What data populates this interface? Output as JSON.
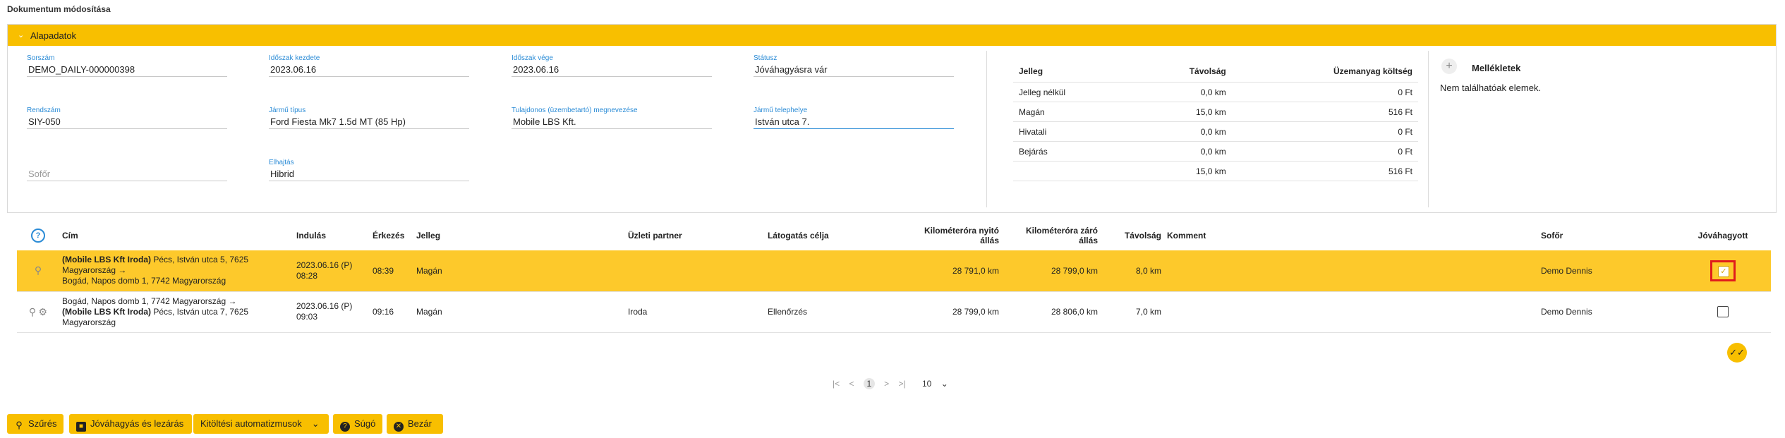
{
  "page_title": "Dokumentum módosítása",
  "panel": {
    "title": "Alapadatok",
    "fields": {
      "sorszam": {
        "label": "Sorszám",
        "value": "DEMO_DAILY-000000398"
      },
      "idoszak_kezdete": {
        "label": "Időszak kezdete",
        "value": "2023.06.16"
      },
      "idoszak_vege": {
        "label": "Időszak vége",
        "value": "2023.06.16"
      },
      "statusz": {
        "label": "Státusz",
        "value": "Jóváhagyásra vár"
      },
      "rendszam": {
        "label": "Rendszám",
        "value": "SIY-050"
      },
      "jarmu_tipus": {
        "label": "Jármű típus",
        "value": "Ford Fiesta Mk7 1.5d MT (85 Hp)"
      },
      "tulajdonos": {
        "label": "Tulajdonos (üzembetartó) megnevezése",
        "value": "Mobile LBS Kft."
      },
      "telephely": {
        "label": "Jármű telephelye",
        "value": "István utca 7."
      },
      "sofor": {
        "placeholder": "Sofőr"
      },
      "elohajtas": {
        "label": "Elhajtás",
        "value": "Hibrid"
      }
    },
    "summary": {
      "headers": {
        "jelleg": "Jelleg",
        "tavolsag": "Távolság",
        "koltseg": "Üzemanyag költség"
      },
      "rows": [
        {
          "jelleg": "Jelleg nélkül",
          "tavolsag": "0,0 km",
          "koltseg": "0 Ft"
        },
        {
          "jelleg": "Magán",
          "tavolsag": "15,0 km",
          "koltseg": "516 Ft"
        },
        {
          "jelleg": "Hivatali",
          "tavolsag": "0,0 km",
          "koltseg": "0 Ft"
        },
        {
          "jelleg": "Bejárás",
          "tavolsag": "0,0 km",
          "koltseg": "0 Ft"
        },
        {
          "jelleg": "",
          "tavolsag": "15,0 km",
          "koltseg": "516 Ft"
        }
      ]
    },
    "attachments": {
      "title": "Mellékletek",
      "empty": "Nem találhatóak elemek."
    }
  },
  "grid": {
    "headers": {
      "cim": "Cím",
      "indulas": "Indulás",
      "erkezes": "Érkezés",
      "jelleg": "Jelleg",
      "partner": "Üzleti partner",
      "cel": "Látogatás célja",
      "nyito": "Kilométeróra nyitó állás",
      "zaro": "Kilométeróra záró állás",
      "tavolsag": "Távolság",
      "komment": "Komment",
      "sofor": "Sofőr",
      "jovahagyott": "Jóváhagyott"
    },
    "rows": [
      {
        "addr_bold1": "(Mobile LBS Kft Iroda)",
        "addr_line1": " Pécs, István utca 5, 7625",
        "addr_line2": "Magyarország →",
        "addr_line3": "Bogád, Napos domb 1, 7742 Magyarország",
        "indulas_date": "2023.06.16 (P)",
        "indulas_time": "08:28",
        "erkezes": "08:39",
        "jelleg": "Magán",
        "partner": "",
        "cel": "",
        "nyito": "28 791,0 km",
        "zaro": "28 799,0 km",
        "tavolsag": "8,0 km",
        "komment": "",
        "sofor": "Demo Dennis"
      },
      {
        "addr_line1": "Bogád, Napos domb 1, 7742 Magyarország →",
        "addr_bold2": "(Mobile LBS Kft Iroda)",
        "addr_line2": " Pécs, István utca 7, 7625",
        "addr_line3": "Magyarország",
        "indulas_date": "2023.06.16 (P)",
        "indulas_time": "09:03",
        "erkezes": "09:16",
        "jelleg": "Magán",
        "partner": "Iroda",
        "cel": "Ellenőrzés",
        "nyito": "28 799,0 km",
        "zaro": "28 806,0 km",
        "tavolsag": "7,0 km",
        "komment": "",
        "sofor": "Demo Dennis"
      }
    ]
  },
  "pager": {
    "current": "1",
    "page_size": "10"
  },
  "buttons": {
    "szures": "Szűrés",
    "jovahagyas": "Jóváhagyás és lezárás",
    "kitoltesi": "Kitöltési automatizmusok",
    "sugo": "Súgó",
    "bezar": "Bezár"
  },
  "colors": {
    "accent": "#f8bf00",
    "selected_row": "#fdc92b",
    "label_blue": "#2a8bd6",
    "highlight": "#e01c1c"
  }
}
